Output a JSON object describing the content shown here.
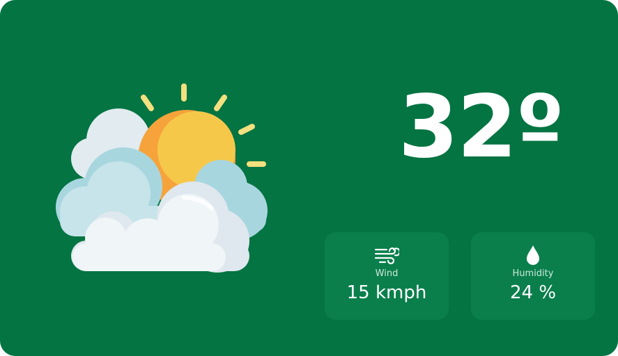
{
  "weather": {
    "condition_icon": "sun-behind-clouds-icon",
    "temperature": "32º"
  },
  "stats": {
    "wind": {
      "icon": "wind-icon",
      "label": "Wind",
      "value": "15 kmph"
    },
    "humidity": {
      "icon": "water-drop-icon",
      "label": "Humidity",
      "value": "24 %"
    }
  },
  "colors": {
    "card_background": "#037442",
    "stat_card_background": "#0a7f4c",
    "text": "#ffffff",
    "sun": "#f6b73c",
    "cloud": "#e9f1f5"
  }
}
